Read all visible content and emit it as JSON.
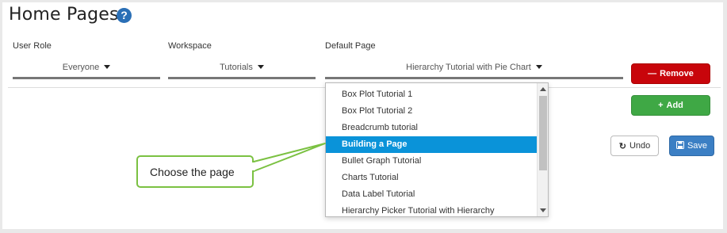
{
  "page": {
    "title": "Home Pages"
  },
  "headers": {
    "user_role": "User Role",
    "workspace": "Workspace",
    "default_page": "Default Page"
  },
  "row": {
    "user_role": "Everyone",
    "workspace": "Tutorials",
    "default_page": "Hierarchy Tutorial with Pie Chart"
  },
  "buttons": {
    "remove": "Remove",
    "add": "Add",
    "undo": "Undo",
    "save": "Save"
  },
  "dropdown_list": {
    "items": [
      "Box Plot Tutorial 1",
      "Box Plot Tutorial 2",
      "Breadcrumb tutorial",
      "Building a Page",
      "Bullet Graph Tutorial",
      "Charts Tutorial",
      "Data Label Tutorial",
      "Hierarchy Picker Tutorial with Hierarchy"
    ],
    "selected": "Building a Page"
  },
  "callout": {
    "text": "Choose the page"
  },
  "colors": {
    "remove": "#c8050b",
    "add": "#3fa845",
    "save": "#3b7fc4",
    "selected": "#0a93d9",
    "callout_border": "#7bc142",
    "help": "#2a6fb6"
  },
  "icons": {
    "help": "question-circle-icon",
    "remove": "minus-icon",
    "add": "plus-icon",
    "undo": "undo-icon",
    "save": "floppy-disk-icon"
  }
}
